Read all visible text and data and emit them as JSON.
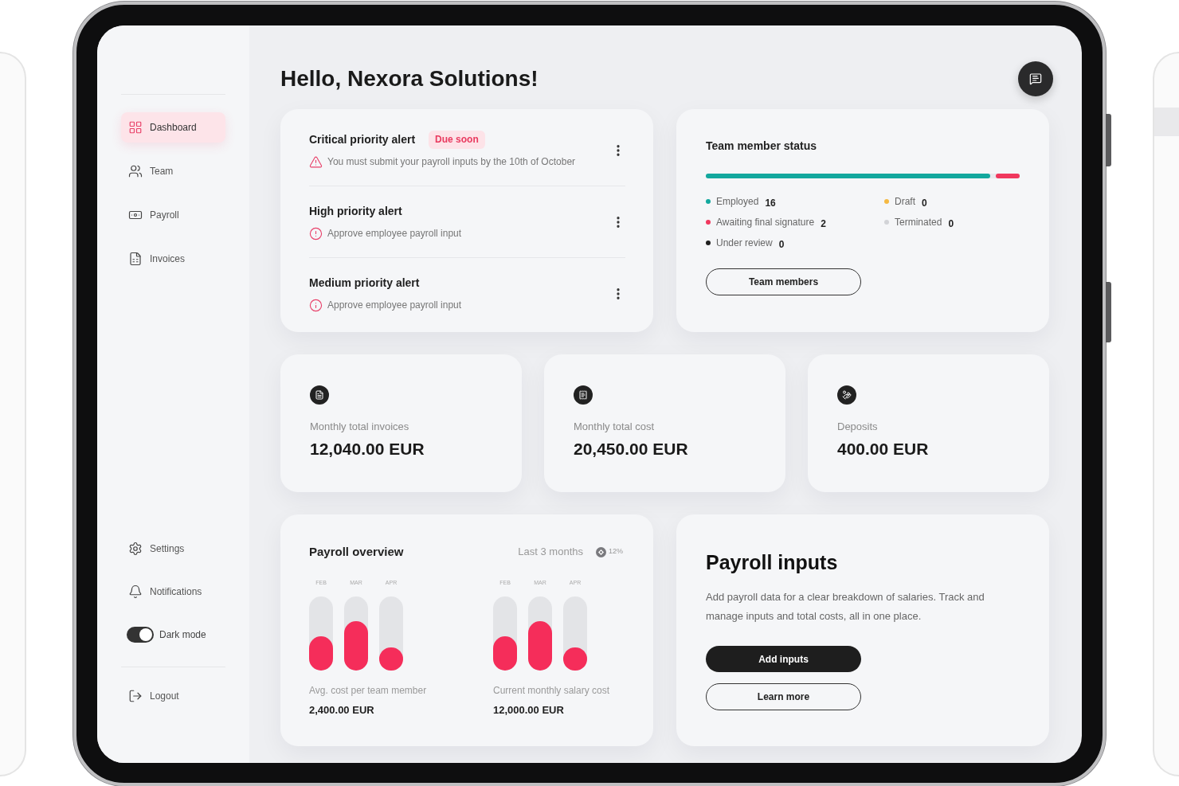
{
  "sidebar": {
    "items": [
      {
        "label": "Dashboard",
        "selected": true
      },
      {
        "label": "Team",
        "selected": false
      },
      {
        "label": "Payroll",
        "selected": false
      },
      {
        "label": "Invoices",
        "selected": false
      }
    ],
    "bottom_items": [
      {
        "label": "Settings",
        "selected": false
      },
      {
        "label": "Notifications",
        "selected": false
      }
    ],
    "dark_mode": {
      "label": "Dark mode",
      "on": true
    },
    "logout": {
      "label": "Logout"
    }
  },
  "header": {
    "greeting": "Hello, Nexora Solutions!"
  },
  "alerts": [
    {
      "kind": "warning",
      "title": "Critical priority alert",
      "badge": "Due soon",
      "message": "You must submit your payroll inputs by the 10th of October"
    },
    {
      "kind": "error",
      "title": "High priority alert",
      "message": "Approve employee payroll input"
    },
    {
      "kind": "info",
      "title": "Medium priority alert",
      "message": "Approve employee payroll input"
    }
  ],
  "team_status": {
    "title": "Team member status",
    "statuses": [
      {
        "label": "Employed",
        "count": "16",
        "color": "#13a89e",
        "level": 0.906
      },
      {
        "label": "Draft",
        "count": "0",
        "color": "#f5b942"
      },
      {
        "label": "Awaiting final signature",
        "count": "2",
        "color": "#f0385e",
        "level": 0.076
      },
      {
        "label": "Terminated",
        "count": "0",
        "color": "#d2d3d7"
      },
      {
        "label": "Under review",
        "count": "0",
        "color": "#1f1f1f"
      }
    ],
    "button": "Team members"
  },
  "stats": [
    {
      "label": "Monthly total invoices",
      "value": "12,040.00 EUR"
    },
    {
      "label": "Monthly total cost",
      "value": "20,450.00 EUR"
    },
    {
      "label": "Deposits",
      "value": "400.00 EUR"
    }
  ],
  "payroll_overview": {
    "title": "Payroll overview",
    "period": "Last 3 months",
    "change": "12%",
    "charts": [
      {
        "bars": [
          {
            "label": "FEB",
            "level": 0.46
          },
          {
            "label": "MAR",
            "level": 0.67
          },
          {
            "label": "APR",
            "level": 0.31
          }
        ],
        "caption": "Avg. cost per team member",
        "value": "2,400.00 EUR"
      },
      {
        "bars": [
          {
            "label": "FEB",
            "level": 0.46
          },
          {
            "label": "MAR",
            "level": 0.67
          },
          {
            "label": "APR",
            "level": 0.31
          }
        ],
        "caption": "Current monthly salary cost",
        "value": "12,000.00 EUR"
      }
    ]
  },
  "payroll_inputs": {
    "title": "Payroll inputs",
    "description": "Add payroll data for a clear breakdown of salaries. Track and manage inputs and total costs, all in one place.",
    "buttons": [
      {
        "label": "Add inputs",
        "kind": "primary"
      },
      {
        "label": "Learn more",
        "kind": "secondary"
      }
    ]
  }
}
